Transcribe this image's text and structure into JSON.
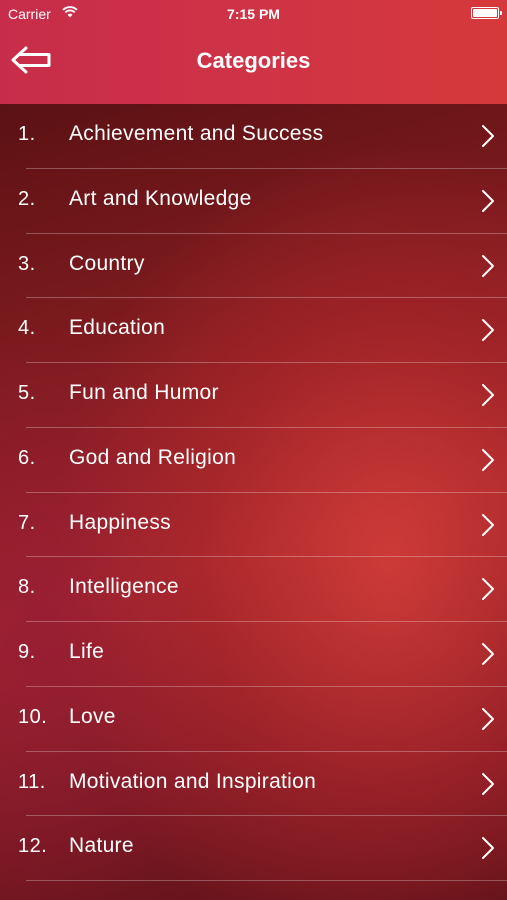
{
  "status_bar": {
    "carrier": "Carrier",
    "time": "7:15 PM"
  },
  "header": {
    "title": "Categories",
    "back_icon": "back-arrow-icon"
  },
  "categories": [
    {
      "number": "1.",
      "label": "Achievement and Success"
    },
    {
      "number": "2.",
      "label": "Art and Knowledge"
    },
    {
      "number": "3.",
      "label": "Country"
    },
    {
      "number": "4.",
      "label": "Education"
    },
    {
      "number": "5.",
      "label": "Fun and Humor"
    },
    {
      "number": "6.",
      "label": "God and Religion"
    },
    {
      "number": "7.",
      "label": "Happiness"
    },
    {
      "number": "8.",
      "label": "Intelligence"
    },
    {
      "number": "9.",
      "label": "Life"
    },
    {
      "number": "10.",
      "label": "Love"
    },
    {
      "number": "11.",
      "label": "Motivation and Inspiration"
    },
    {
      "number": "12.",
      "label": "Nature"
    }
  ],
  "colors": {
    "header": "#cf3346",
    "background": "#8a1f22",
    "text": "#ffffff"
  }
}
